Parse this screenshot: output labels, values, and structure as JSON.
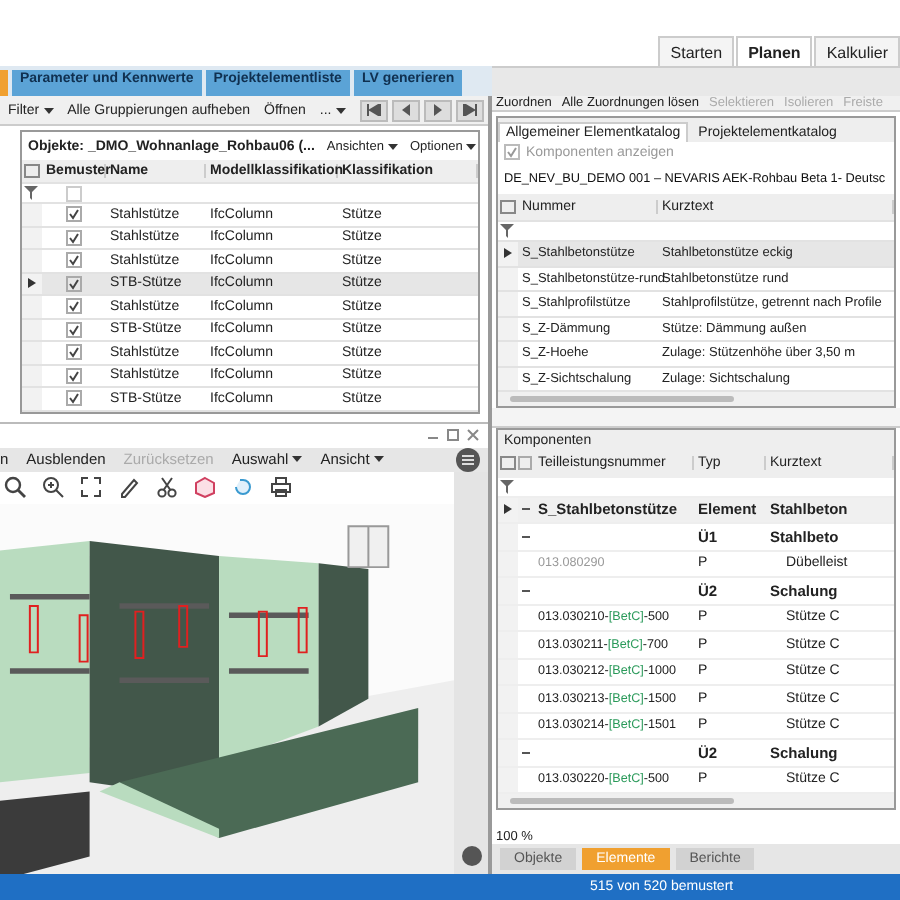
{
  "top_tabs": [
    {
      "label": "Starten",
      "selected": false
    },
    {
      "label": "Planen",
      "selected": true
    },
    {
      "label": "Kalkulier",
      "selected": false
    }
  ],
  "left_tabs": [
    "Parameter und Kennwerte",
    "Projektelementliste",
    "LV generieren"
  ],
  "left_toolbar": [
    {
      "label": "Filter",
      "kind": "dropdown"
    },
    {
      "label": "Alle Gruppierungen aufheben",
      "kind": "button"
    },
    {
      "label": "Öffnen",
      "kind": "button"
    },
    {
      "label": "...",
      "kind": "dropdown"
    }
  ],
  "objects": {
    "filter_checked": false,
    "title": "Objekte: _DMO_Wohnanlage_Rohbau06 (...",
    "menus": [
      "Ansichten",
      "Optionen"
    ],
    "columns": [
      "Bemuster",
      "Name",
      "Modellklassifikation",
      "Klassifikation"
    ],
    "rows": [
      {
        "checked": true,
        "name": "Stahlstütze",
        "model": "IfcColumn",
        "class": "Stütze",
        "selected": false
      },
      {
        "checked": true,
        "name": "Stahlstütze",
        "model": "IfcColumn",
        "class": "Stütze",
        "selected": false
      },
      {
        "checked": true,
        "name": "Stahlstütze",
        "model": "IfcColumn",
        "class": "Stütze",
        "selected": false
      },
      {
        "checked": true,
        "name": "STB-Stütze",
        "model": "IfcColumn",
        "class": "Stütze",
        "selected": true
      },
      {
        "checked": true,
        "name": "Stahlstütze",
        "model": "IfcColumn",
        "class": "Stütze",
        "selected": false
      },
      {
        "checked": true,
        "name": "STB-Stütze",
        "model": "IfcColumn",
        "class": "Stütze",
        "selected": false
      },
      {
        "checked": true,
        "name": "Stahlstütze",
        "model": "IfcColumn",
        "class": "Stütze",
        "selected": false
      },
      {
        "checked": true,
        "name": "Stahlstütze",
        "model": "IfcColumn",
        "class": "Stütze",
        "selected": false
      },
      {
        "checked": true,
        "name": "STB-Stütze",
        "model": "IfcColumn",
        "class": "Stütze",
        "selected": false
      }
    ]
  },
  "viewer_toolbar": [
    {
      "label": "n",
      "kind": "button",
      "disabled": false
    },
    {
      "label": "Ausblenden",
      "kind": "button",
      "disabled": false
    },
    {
      "label": "Zurücksetzen",
      "kind": "button",
      "disabled": true
    },
    {
      "label": "Auswahl",
      "kind": "dropdown",
      "disabled": false
    },
    {
      "label": "Ansicht",
      "kind": "dropdown",
      "disabled": false
    }
  ],
  "right_toolbar": [
    {
      "label": "Zuordnen",
      "disabled": false
    },
    {
      "label": "Alle Zuordnungen lösen",
      "disabled": false
    },
    {
      "label": "Selektieren",
      "disabled": true
    },
    {
      "label": "Isolieren",
      "disabled": true
    },
    {
      "label": "Freiste",
      "disabled": true
    }
  ],
  "catalog": {
    "tabs": [
      {
        "label": "Allgemeiner Elementkatalog",
        "selected": true
      },
      {
        "label": "Projektelementkatalog",
        "selected": false
      }
    ],
    "show_components": {
      "label": "Komponenten anzeigen",
      "checked": true,
      "disabled": true
    },
    "title": "DE_NEV_BU_DEMO 001 – NEVARIS AEK-Rohbau Beta 1- Deutsc",
    "columns": [
      "Nummer",
      "Kurztext"
    ],
    "rows": [
      {
        "number": "S_Stahlbetonstütze",
        "text": "Stahlbetonstütze eckig",
        "selected": true
      },
      {
        "number": "S_Stahlbetonstütze-rund",
        "text": "Stahlbetonstütze rund",
        "selected": false
      },
      {
        "number": "S_Stahlprofilstütze",
        "text": "Stahlprofilstütze, getrennt nach Profile",
        "selected": false
      },
      {
        "number": "S_Z-Dämmung",
        "text": "Stütze: Dämmung außen",
        "selected": false
      },
      {
        "number": "S_Z-Hoehe",
        "text": "Zulage: Stützenhöhe über 3,50 m",
        "selected": false
      },
      {
        "number": "S_Z-Sichtschalung",
        "text": "Zulage: Sichtschalung",
        "selected": false
      }
    ]
  },
  "components": {
    "title": "Komponenten",
    "columns": [
      "Teilleistungsnummer",
      "Typ",
      "Kurztext"
    ],
    "rows": [
      {
        "kind": "element",
        "number": "S_Stahlbetonstütze",
        "type": "Element",
        "text": "Stahlbeton",
        "selected": true
      },
      {
        "kind": "group",
        "type": "Ü1",
        "text": "Stahlbeto",
        "selected": false
      },
      {
        "kind": "item",
        "number": "013.080290",
        "type": "P",
        "text": "Dübelleist",
        "disabled": true,
        "selected": false
      },
      {
        "kind": "group",
        "type": "Ü2",
        "text": "Schalung",
        "selected": false
      },
      {
        "kind": "item",
        "number": "013.030210-",
        "tag": "[BetC]",
        "suffix": "-500",
        "type": "P",
        "text": "Stütze C",
        "disabled": false,
        "selected": false
      },
      {
        "kind": "item",
        "number": "013.030211-",
        "tag": "[BetC]",
        "suffix": "-700",
        "type": "P",
        "text": "Stütze C",
        "disabled": false,
        "selected": false
      },
      {
        "kind": "item",
        "number": "013.030212-",
        "tag": "[BetC]",
        "suffix": "-1000",
        "type": "P",
        "text": "Stütze C",
        "disabled": false,
        "selected": false
      },
      {
        "kind": "item",
        "number": "013.030213-",
        "tag": "[BetC]",
        "suffix": "-1500",
        "type": "P",
        "text": "Stütze C",
        "disabled": false,
        "selected": false
      },
      {
        "kind": "item",
        "number": "013.030214-",
        "tag": "[BetC]",
        "suffix": "-1501",
        "type": "P",
        "text": "Stütze C",
        "disabled": false,
        "selected": false
      },
      {
        "kind": "group",
        "type": "Ü2",
        "text": "Schalung",
        "selected": false
      },
      {
        "kind": "item",
        "number": "013.030220-",
        "tag": "[BetC]",
        "suffix": "-500",
        "type": "P",
        "text": "Stütze C",
        "disabled": false,
        "selected": false
      }
    ]
  },
  "zoom": "100 %",
  "bottom_tabs": [
    {
      "label": "Objekte",
      "selected": false
    },
    {
      "label": "Elemente",
      "selected": true
    },
    {
      "label": "Berichte",
      "selected": false
    }
  ],
  "status_bar": "515 von 520 bemustert"
}
